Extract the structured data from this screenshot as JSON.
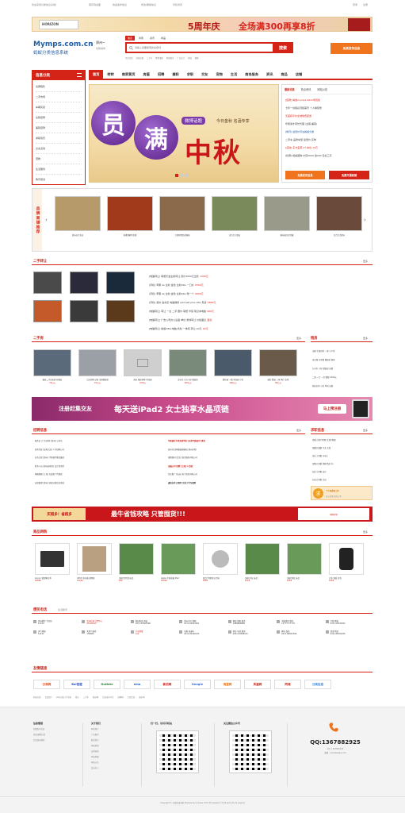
{
  "topbar": {
    "welcome": "欢迎来到分类信息系统！",
    "links": [
      "保存到桌面",
      "快速发布信息",
      "修改/删除信息",
      "手机浏览"
    ],
    "login": "登录",
    "register": "注册"
  },
  "top_banner": {
    "brand": "5周年庆",
    "headline": "全场满300再享8折",
    "sub": "HORIZON"
  },
  "header": {
    "logo_domain": "Mymps.com.cn",
    "logo_name": "蚂蚁分类信息系统",
    "city_label": "郑州~",
    "city_change": "切换城市",
    "search_tabs": [
      "信息",
      "商家",
      "资讯",
      "商品"
    ],
    "search_placeholder": "请输入您要搜索的关键词",
    "search_button": "搜索",
    "hot_keywords": [
      "美女贷款",
      "房屋出租",
      "二手车",
      "聘用兼职",
      "家政服务",
      "广告设计",
      "同城",
      "搬家"
    ],
    "post_button": "免费发布信息"
  },
  "sidebar": {
    "title": "信息分类",
    "items": [
      "房屋租售",
      "二手市场",
      "车辆买卖",
      "全职招聘",
      "兼职招聘",
      "求职简历",
      "交友活动",
      "宠物",
      "生活服务",
      "教育培训"
    ]
  },
  "nav": {
    "items": [
      "首页",
      "转转",
      "商家黄页",
      "房屋",
      "招聘",
      "兼职",
      "求职",
      "交友",
      "宠物",
      "生活",
      "商务服务",
      "资讯",
      "商品",
      "店铺"
    ]
  },
  "hero": {
    "char1": "员",
    "char2": "满",
    "tag": "微博话题",
    "subtitle": "今日金秋 名酒专享",
    "title": "中秋"
  },
  "notice": {
    "tabs": [
      "最新消息",
      "热点资讯",
      "网站公告"
    ],
    "items": [
      "[招聘] 蚂蚁mymps 2011年终奖",
      "七年一剑丽彩顶级美景 个人精装修",
      "无差别平价全城免费配送",
      "华夏通才家长代理 (全职/兼职)",
      "[教育] 最低价尽在蚂蚁分类",
      "二手车 品牌车型 最低价 买单",
      "[活动] 东方名苑 2个车位 15万",
      "[优惠] 蚂蚁团购 价值2000 送200 仅此三天"
    ],
    "btn_left": "免费发布信息",
    "btn_right": "免费开通商铺"
  },
  "brand_strip": {
    "title": "品牌商铺推荐",
    "items": [
      {
        "name": "凯乐石专卖店",
        "color": "#b69a6a"
      },
      {
        "name": "秋香酒家特色菜",
        "color": "#a13a1a"
      },
      {
        "name": "大理风情民宿客栈",
        "color": "#8a6a4a"
      },
      {
        "name": "金百合大酒店",
        "color": "#7a8a5a"
      },
      {
        "name": "康乐园文化传媒",
        "color": "#9a9a8a"
      },
      {
        "name": "百合生活超市",
        "color": "#6a4a3a"
      }
    ]
  },
  "second_hand": {
    "title": "二手转让",
    "more": "更多",
    "thumbs": [
      {
        "color": "#4a4a4a"
      },
      {
        "color": "#2a2a3a"
      },
      {
        "color": "#1a2a3a"
      },
      {
        "color": "#c45a2a"
      },
      {
        "color": "#3a3a3a"
      },
      {
        "color": "#5a3a1a"
      }
    ],
    "items": [
      {
        "text": "[电脑转让] 联想乐金全新转让 原价3000元出售",
        "price": "1200元"
      },
      {
        "text": "[手机] 苹果 4s 全新 金色 全新16G 一口价",
        "price": "2500元"
      },
      {
        "text": "[手机] 苹果 4s 全新 金色 全新16G 整一个",
        "price": "2600元"
      },
      {
        "text": "[手机] 郑州 金水区 电脑维修 iphone6 plus 16G 现货",
        "price": "5800元"
      },
      {
        "text": "[电脑转让] 转让 一台 二手 戴尔 联想 华硕 笔记本电脑",
        "price": "900元"
      },
      {
        "text": "[电脑转让] 广告公司办公设备 单位 整体转让 价格面议",
        "price": "面议"
      },
      {
        "text": "[电脑转让] 蚂蚁DELL电脑 商务 一体机 转让 20元",
        "price": "20元"
      }
    ]
  },
  "rentals": {
    "title": "二手房",
    "more": "更多",
    "items": [
      {
        "name": "嵩县二手房出售 好楼层",
        "price": "76万元",
        "color": "#5a6a7a"
      },
      {
        "name": "山水别墅 出售 全新精装修",
        "price": "67万元",
        "color": "#9aa0a5"
      },
      {
        "name": "西区 独栋别墅 带花园",
        "price": "0.80元",
        "color": "#cfcfcf"
      },
      {
        "name": "金水区 东方小区 精装修",
        "price": "150万元",
        "color": "#7a8a7a"
      },
      {
        "name": "碧桂园 一楼 带花园 小区",
        "price": "166万元",
        "color": "#4a5a6a"
      },
      {
        "name": "城区 精装 三室 两厅 出售",
        "price": "85万元",
        "color": "#6a5a4a"
      }
    ],
    "side_title": "租房",
    "side_more": "更多",
    "side_items": [
      "出租 生源好的 一室 小户型",
      "金水路 东风路 精装修 两室",
      "万水中 小区 精装修 出租",
      "二室 一厅 一卫 整租 1000元",
      "科技市场 小区 单间 出租"
    ]
  },
  "mid_banner": {
    "left": "注册赶集交友",
    "mid": "每天送iPad2 女士独享水晶项链",
    "btn": "马上预注册"
  },
  "jobs": {
    "title": "招聘信息",
    "more": "更多",
    "left": [
      "服务员 (广东深圳) [郑州] 公司名",
      "商务代表 [深圳大浪] 人才招聘公司",
      "业务主管 [郑州] 华夏通才教育集团",
      "财务人员 [郑州高新区] 会计事务所",
      "网络客服 [上海] 百度推广代理商",
      "运营助理 [郑州] 蚂蚁分类信息系统"
    ],
    "right": [
      "华夏通才中英双语学校 [天津华夏通才] 教育",
      "郑州开封网络编辑客服 [郑州永利]",
      "课程顾问 [北京] 航空服务有限公司",
      "金融公司 招聘 [上海] 人事部",
      "淘宝推广 [杭州] 电子商务有限公司",
      "通信技术工程师 [北京] 华为招聘"
    ],
    "side_title": "求职信息",
    "side_more": "更多",
    "side_items": [
      "[物业] 客户经理 (主管/求职)",
      "[兼职] 兼职 专业 文案",
      "[技工] 求职 水电工",
      "[销售] 求职 销售代表 6人",
      "[会计] 求职 会计",
      "[文员] 求职 文员"
    ],
    "side_banner": "个人免费招工作",
    "side_banner_sub": "先人后事 发布工作"
  },
  "promo_bar": {
    "left": "买超多！省超多",
    "mid": "最牛省钱攻略 只管囤货!!!",
    "right": "网购好物"
  },
  "goods": {
    "title": "商品网购",
    "more": "更多",
    "items": [
      {
        "name": "lenovo 联想笔记本",
        "price": "¥3888"
      },
      {
        "name": "UZVO 多功能 储物柜",
        "price": "¥1499"
      },
      {
        "name": "全棉 四件套 床品",
        "price": "¥99"
      },
      {
        "name": "Apple 平板电脑 iPad",
        "price": "¥2999"
      },
      {
        "name": "双耳 不锈钢 压力锅",
        "price": "¥268"
      },
      {
        "name": "全棉 印花 床品",
        "price": "¥128"
      },
      {
        "name": "全棉 斜纹 床品",
        "price": "¥168"
      },
      {
        "name": "户外 双肩 背包",
        "price": "¥189"
      }
    ]
  },
  "phones": {
    "title": "便民电话",
    "subtitle": "生活助手",
    "items": [
      {
        "name": "郑州烟草 专卖局",
        "num": "12313"
      },
      {
        "name": "查询在线 订票中心",
        "num": "95105105"
      },
      {
        "name": "鞋材批发 商城",
        "num": "0371-55665566"
      },
      {
        "name": "郑州东区 客服",
        "num": "0371-63523001"
      },
      {
        "name": "家政 管家 服务",
        "num": "1888888888"
      },
      {
        "name": "电脑维修 服务",
        "num": "13777777776"
      },
      {
        "name": "开锁 换锁",
        "num": "0371-54545452"
      },
      {
        "name": "天气预报",
        "num": "12121"
      },
      {
        "name": "天然气抢修",
        "num": "156666"
      },
      {
        "name": "汽车救援",
        "num": "122"
      },
      {
        "name": "电视 直通车",
        "num": "0411-84300222"
      },
      {
        "name": "物业 电话 服务",
        "num": "0411-84489031"
      },
      {
        "name": "家电 维修",
        "num": "0411-86502099"
      },
      {
        "name": "快递 物流",
        "num": "0411-86502025"
      }
    ]
  },
  "friends": {
    "title": "友情链接",
    "logos": [
      {
        "text": "分类网",
        "color": "#e84c1a"
      },
      {
        "text": "Bai百度",
        "color": "#2c52c9"
      },
      {
        "text": "DuNote",
        "color": "#2b8a3a"
      },
      {
        "text": "ema",
        "color": "#1a6ac9"
      },
      {
        "text": "新浪网",
        "color": "#d42418"
      },
      {
        "text": "Google",
        "color": "#3a6ad8"
      },
      {
        "text": "淘宝网",
        "color": "#ff6a00"
      },
      {
        "text": "凤凰网",
        "color": "#c92a1a"
      },
      {
        "text": "同城",
        "color": "#d42418"
      },
      {
        "text": "分类信息",
        "color": "#3a8ad8"
      }
    ],
    "text_links": [
      "蚂蚁分类",
      "百度推广",
      "php分类门户系统",
      "猎头",
      "二手车",
      "租房网",
      "信息发布平台",
      "招聘网",
      "分类信息",
      "城市网"
    ]
  },
  "footer": {
    "col1_title": "信息管理",
    "col1_items": [
      "免费发布信息",
      "修改/删除信息",
      "信息快速搜索"
    ],
    "col2_title": "关于我们",
    "col2_items": [
      "网站简介",
      "广告服务",
      "联系我们",
      "网站帮助",
      "友情链接",
      "网站地图",
      "网站公告",
      "会员中心"
    ],
    "qr1_title": "扫一扫，访问手机站",
    "qr2_title": "关注微信公众号",
    "qq_label": "QQ:1367882925",
    "qq_sub1": "QQ: 1367882925",
    "qq_sub2": "邮箱：mymps@qq.com",
    "copyright": "Copyright © 分类信息系统 Powered by mymps 5.8.0 Processed in 0.04 seconds 22 queries"
  },
  "colors": {
    "accent": "#d42418",
    "orange": "#f0741e",
    "navy": "#1f5ea8"
  }
}
